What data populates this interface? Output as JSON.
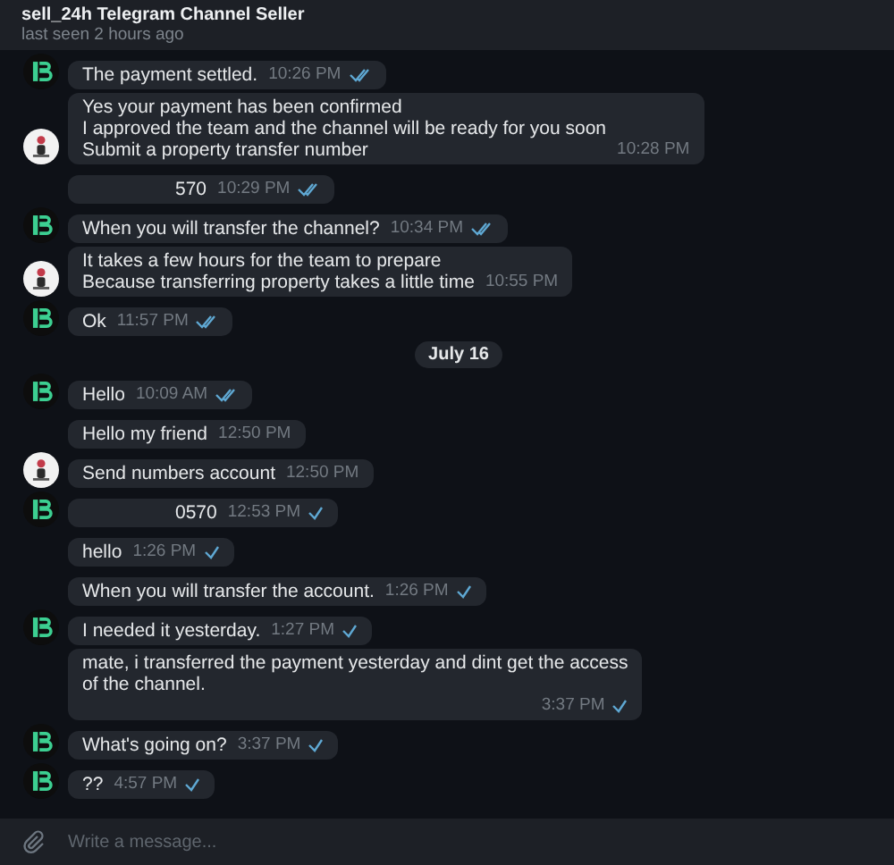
{
  "header": {
    "title": "sell_24h Telegram Channel Seller",
    "status": "last seen 2 hours ago"
  },
  "messages": [
    {
      "kind": "message",
      "lines": [
        "The payment settled."
      ],
      "time": "10:26 PM",
      "read": true,
      "avatar": {
        "kind": "logo"
      }
    },
    {
      "kind": "message",
      "lines": [
        "Yes your payment has been confirmed",
        "I approved the team and the channel will be ready for you soon",
        "Submit a property transfer number"
      ],
      "time": "10:28 PM",
      "avatar": {
        "kind": "person"
      }
    },
    {
      "kind": "message",
      "lines": [
        "570"
      ],
      "time": "10:29 PM",
      "read": true,
      "right_aligned": true
    },
    {
      "kind": "message",
      "lines": [
        "When you will transfer the channel?"
      ],
      "time": "10:34 PM",
      "read": true,
      "avatar": {
        "kind": "logo"
      }
    },
    {
      "kind": "message",
      "lines": [
        "It takes a few hours for the team to prepare",
        "Because transferring property takes a little time"
      ],
      "time": "10:55 PM",
      "avatar": {
        "kind": "person"
      }
    },
    {
      "kind": "message",
      "lines": [
        "Ok"
      ],
      "time": "11:57 PM",
      "read": true,
      "avatar": {
        "kind": "logo"
      }
    },
    {
      "kind": "date",
      "label": "July 16"
    },
    {
      "kind": "message",
      "lines": [
        "Hello"
      ],
      "time": "10:09 AM",
      "read": true,
      "avatar": {
        "kind": "logo"
      }
    },
    {
      "kind": "message",
      "lines": [
        "Hello my friend"
      ],
      "time": "12:50 PM"
    },
    {
      "kind": "message",
      "lines": [
        "Send numbers account"
      ],
      "time": "12:50 PM",
      "avatar": {
        "kind": "person"
      }
    },
    {
      "kind": "message",
      "lines": [
        "0570"
      ],
      "time": "12:53 PM",
      "read": false,
      "avatar": {
        "kind": "logo"
      },
      "right_aligned": true
    },
    {
      "kind": "message",
      "lines": [
        "hello"
      ],
      "time": "1:26 PM",
      "read": false
    },
    {
      "kind": "message",
      "lines": [
        "When you will transfer the account."
      ],
      "time": "1:26 PM",
      "read": false
    },
    {
      "kind": "message",
      "lines": [
        "I needed it yesterday."
      ],
      "time": "1:27 PM",
      "read": false,
      "avatar": {
        "kind": "logo"
      }
    },
    {
      "kind": "message",
      "lines": [
        "mate, i transferred the payment yesterday and dint get the access",
        "of the channel."
      ],
      "time": "3:37 PM",
      "read": false,
      "time_below": true
    },
    {
      "kind": "message",
      "lines": [
        "What's going on?"
      ],
      "time": "3:37 PM",
      "read": false,
      "avatar": {
        "kind": "logo"
      }
    },
    {
      "kind": "message",
      "lines": [
        "??"
      ],
      "time": "4:57 PM",
      "read": false,
      "avatar": {
        "kind": "logo"
      }
    }
  ],
  "composer": {
    "placeholder": "Write a message..."
  }
}
